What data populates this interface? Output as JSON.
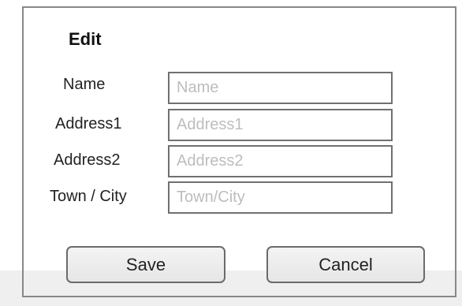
{
  "dialog": {
    "title": "Edit"
  },
  "form": {
    "fields": [
      {
        "label": "Name",
        "placeholder": "Name",
        "value": ""
      },
      {
        "label": "Address1",
        "placeholder": "Address1",
        "value": ""
      },
      {
        "label": "Address2",
        "placeholder": "Address2",
        "value": ""
      },
      {
        "label": "Town / City",
        "placeholder": "Town/City",
        "value": ""
      }
    ]
  },
  "buttons": {
    "save_label": "Save",
    "cancel_label": "Cancel"
  }
}
